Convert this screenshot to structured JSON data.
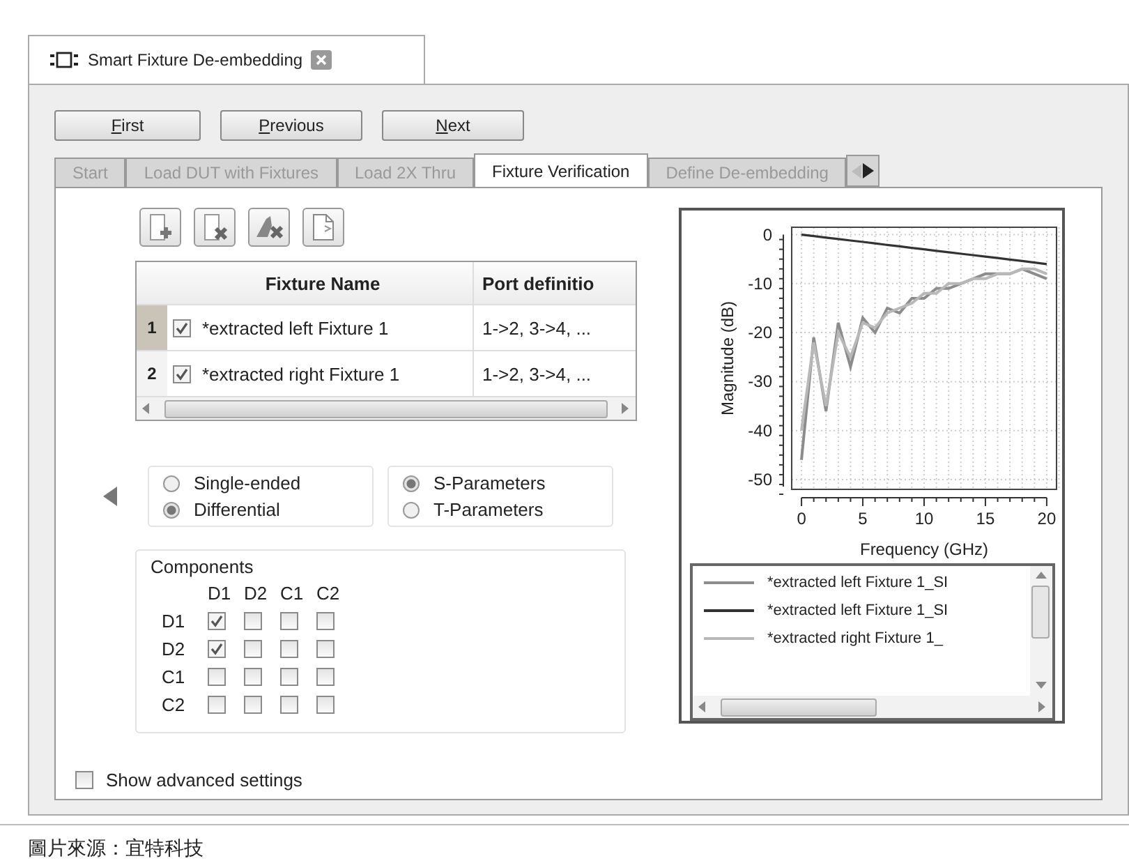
{
  "document_tab": {
    "title": "Smart Fixture De-embedding"
  },
  "nav_buttons": [
    {
      "label": "First"
    },
    {
      "label": "Previous"
    },
    {
      "label": "Next"
    }
  ],
  "tabs": [
    {
      "label": "Start",
      "selected": false
    },
    {
      "label": "Load DUT with Fixtures",
      "selected": false
    },
    {
      "label": "Load 2X Thru",
      "selected": false
    },
    {
      "label": "Fixture Verification",
      "selected": true
    },
    {
      "label": "Define De-embedding",
      "selected": false
    }
  ],
  "fixture_table": {
    "columns": [
      "Fixture Name",
      "Port definitio"
    ],
    "rows": [
      {
        "number": "1",
        "selected": true,
        "checked": true,
        "name": "*extracted left Fixture 1",
        "ports": "1->2, 3->4, ..."
      },
      {
        "number": "2",
        "selected": false,
        "checked": true,
        "name": "*extracted right Fixture 1",
        "ports": "1->2, 3->4, ..."
      }
    ]
  },
  "signal_mode": [
    {
      "label": "Single-ended",
      "selected": false
    },
    {
      "label": "Differential",
      "selected": true
    }
  ],
  "parameter_type": [
    {
      "label": "S-Parameters",
      "selected": true
    },
    {
      "label": "T-Parameters",
      "selected": false
    }
  ],
  "components": {
    "title": "Components",
    "columns": [
      "D1",
      "D2",
      "C1",
      "C2"
    ],
    "rows": [
      {
        "label": "D1",
        "checked": [
          true,
          false,
          false,
          false
        ]
      },
      {
        "label": "D2",
        "checked": [
          true,
          false,
          false,
          false
        ]
      },
      {
        "label": "C1",
        "checked": [
          false,
          false,
          false,
          false
        ]
      },
      {
        "label": "C2",
        "checked": [
          false,
          false,
          false,
          false
        ]
      }
    ]
  },
  "chart": {
    "chart_data": {
      "type": "line",
      "xlabel": "Frequency (GHz)",
      "ylabel": "Magnitude (dB)",
      "x": [
        0,
        1,
        2,
        3,
        4,
        5,
        6,
        7,
        8,
        9,
        10,
        11,
        12,
        13,
        14,
        15,
        16,
        17,
        18,
        19,
        20
      ],
      "xlim": [
        -0.8,
        20.8
      ],
      "ylim": [
        -52,
        1.5
      ],
      "xticks": [
        0,
        5,
        10,
        15,
        20
      ],
      "yticks": [
        0,
        -10,
        -20,
        -30,
        -40,
        -50
      ],
      "grid": true,
      "series": [
        {
          "name": "*extracted left Fixture 1_SI",
          "color": "#8c8c8c",
          "values": [
            -46,
            -21,
            -36,
            -18,
            -27,
            -17,
            -20,
            -15,
            -16,
            -13,
            -13,
            -11,
            -11,
            -10,
            -9,
            -8,
            -8,
            -8,
            -7,
            -8,
            -9
          ]
        },
        {
          "name": "*extracted left Fixture 1_SI",
          "color": "#333333",
          "values": [
            0,
            -0.3,
            -0.6,
            -0.9,
            -1.2,
            -1.5,
            -1.8,
            -2.1,
            -2.4,
            -2.7,
            -3,
            -3.3,
            -3.6,
            -3.9,
            -4.2,
            -4.5,
            -4.8,
            -5.1,
            -5.4,
            -5.7,
            -6
          ]
        },
        {
          "name": "*extracted right Fixture 1_",
          "color": "#b8b8b8",
          "values": [
            -40,
            -22,
            -35,
            -20,
            -25,
            -18,
            -19,
            -16,
            -15,
            -14,
            -12,
            -12,
            -10,
            -10,
            -9,
            -9,
            -8,
            -8,
            -7,
            -7,
            -8
          ]
        }
      ]
    }
  },
  "advanced": {
    "label": "Show advanced settings",
    "checked": false
  },
  "caption": "圖片來源：宜特科技"
}
